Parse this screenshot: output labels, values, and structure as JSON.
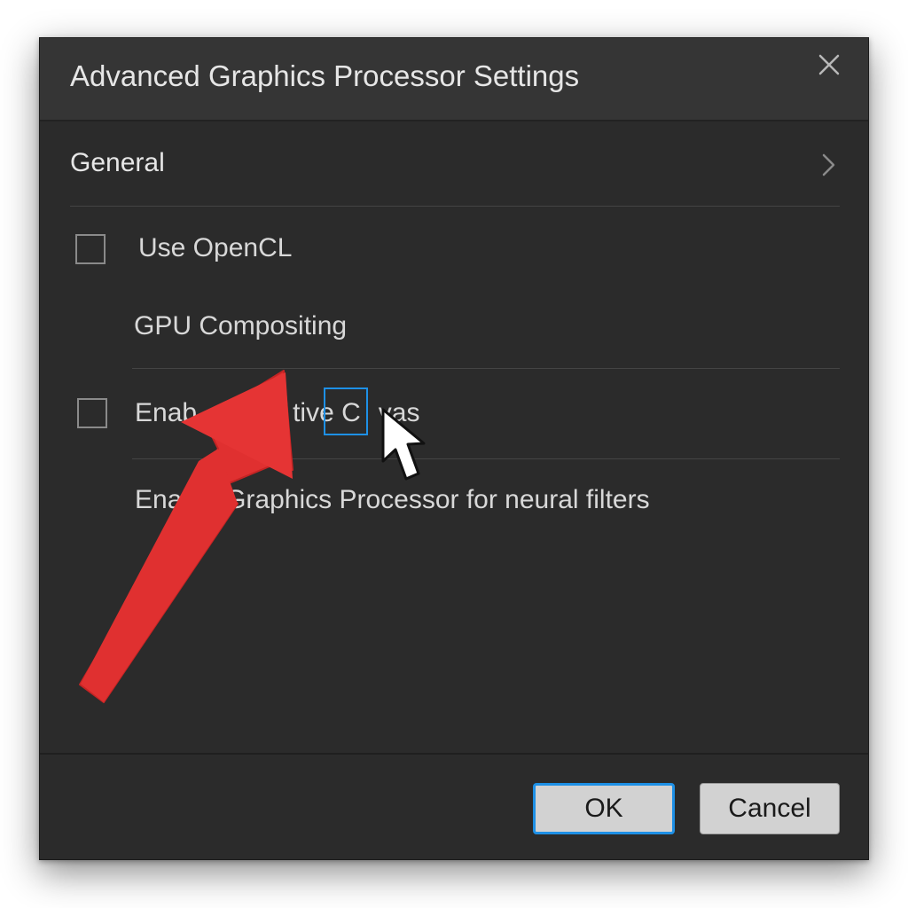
{
  "dialog": {
    "title": "Advanced Graphics Processor Settings",
    "close_icon": "close-icon"
  },
  "section": {
    "title": "General",
    "chevron_icon": "chevron-right-icon"
  },
  "options": [
    {
      "label": "Use OpenCL",
      "checked": false,
      "has_checkbox": true
    },
    {
      "label": "GPU Compositing",
      "has_checkbox": false
    },
    {
      "label": "Enable Native Canvas",
      "visible_fragments": [
        "Enab",
        "tive C",
        "vas"
      ],
      "checked": false,
      "has_checkbox": true
    },
    {
      "label": "Enable Graphics Processor for neural filters",
      "visible_fragments": [
        "Enab",
        "Graphics Processor for neural filters"
      ],
      "has_checkbox": false
    }
  ],
  "buttons": {
    "ok_label": "OK",
    "cancel_label": "Cancel"
  },
  "colors": {
    "dialog_bg": "#2b2b2b",
    "titlebar_bg": "#353535",
    "focus_blue": "#1e90e6",
    "annotation_arrow": "#e03030"
  }
}
